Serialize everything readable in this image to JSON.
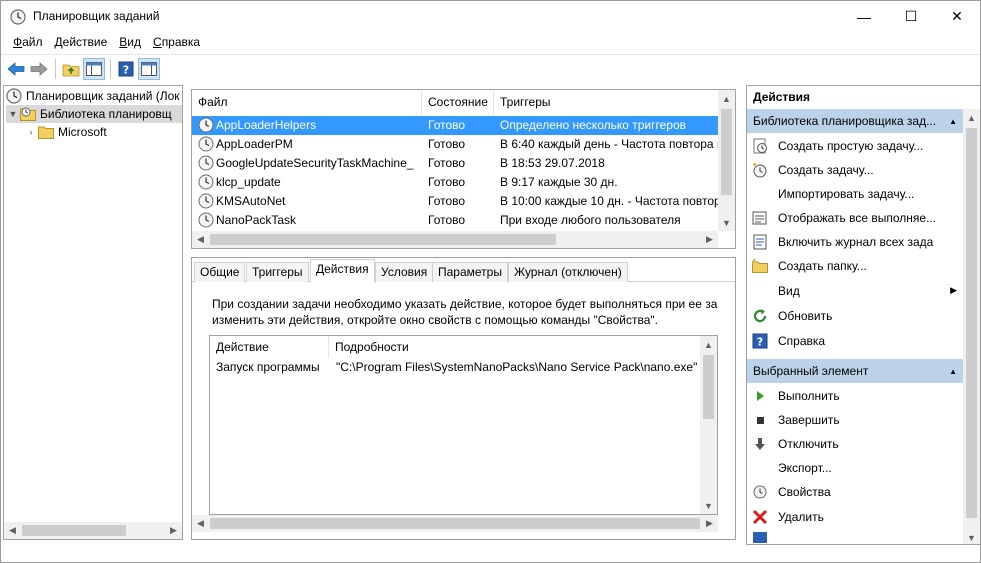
{
  "window": {
    "title": "Планировщик заданий",
    "minimize": "—",
    "maximize": "☐",
    "close": "✕"
  },
  "menu": [
    {
      "key": "Ф",
      "rest": "айл"
    },
    {
      "key": "Д",
      "rest": "ействие"
    },
    {
      "key": "В",
      "rest": "ид"
    },
    {
      "key": "С",
      "rest": "правка"
    }
  ],
  "tree": {
    "root": "Планировщик заданий (Лок",
    "library": "Библиотека планировщ",
    "child": "Microsoft"
  },
  "task_list": {
    "columns": [
      "Файл",
      "Состояние",
      "Триггеры"
    ],
    "rows": [
      {
        "name": "AppLoaderHelpers",
        "status": "Готово",
        "trigger": "Определено несколько триггеров"
      },
      {
        "name": "AppLoaderPM",
        "status": "Готово",
        "trigger": "В 6:40 каждый день - Частота повтора п"
      },
      {
        "name": "GoogleUpdateSecurityTaskMachine_",
        "status": "Готово",
        "trigger": "В 18:53 29.07.2018"
      },
      {
        "name": "klcp_update",
        "status": "Готово",
        "trigger": "В 9:17 каждые 30 дн."
      },
      {
        "name": "KMSAutoNet",
        "status": "Готово",
        "trigger": "В 10:00 каждые 10 дн. - Частота повтора"
      },
      {
        "name": "NanoPackTask",
        "status": "Готово",
        "trigger": "При входе любого пользователя"
      }
    ]
  },
  "details": {
    "tabs": [
      "Общие",
      "Триггеры",
      "Действия",
      "Условия",
      "Параметры",
      "Журнал (отключен)"
    ],
    "active_tab": "Действия",
    "description_line1": "При создании задачи необходимо указать действие, которое будет выполняться при ее запу",
    "description_line2": "изменить эти действия, откройте окно свойств с помощью команды \"Свойства\".",
    "action_columns": [
      "Действие",
      "Подробности"
    ],
    "action_row": {
      "action": "Запуск программы",
      "details": "\"C:\\Program Files\\SystemNanoPacks\\Nano Service Pack\\nano.exe\""
    }
  },
  "actions_pane": {
    "title": "Действия",
    "section1": "Библиотека планировщика зад...",
    "section1_items": [
      {
        "label": "Создать простую задачу...",
        "icon": "create-basic-task-icon"
      },
      {
        "label": "Создать задачу...",
        "icon": "create-task-icon"
      },
      {
        "label": "Импортировать задачу...",
        "icon": "none"
      },
      {
        "label": "Отображать все выполняе...",
        "icon": "display-running-icon"
      },
      {
        "label": "Включить журнал всех зада",
        "icon": "enable-history-icon"
      },
      {
        "label": "Создать папку...",
        "icon": "new-folder-icon"
      },
      {
        "label": "Вид",
        "icon": "none"
      },
      {
        "label": "Обновить",
        "icon": "refresh-icon"
      },
      {
        "label": "Справка",
        "icon": "help-icon"
      }
    ],
    "section2": "Выбранный элемент",
    "section2_items": [
      {
        "label": "Выполнить",
        "icon": "run-icon"
      },
      {
        "label": "Завершить",
        "icon": "end-icon"
      },
      {
        "label": "Отключить",
        "icon": "disable-icon"
      },
      {
        "label": "Экспорт...",
        "icon": "none"
      },
      {
        "label": "Свойства",
        "icon": "properties-icon"
      },
      {
        "label": "Удалить",
        "icon": "delete-icon"
      }
    ]
  },
  "colors": {
    "selection": "#3399ff",
    "section_header": "#bcd2e8",
    "tree_selection": "#d9d9d9"
  }
}
